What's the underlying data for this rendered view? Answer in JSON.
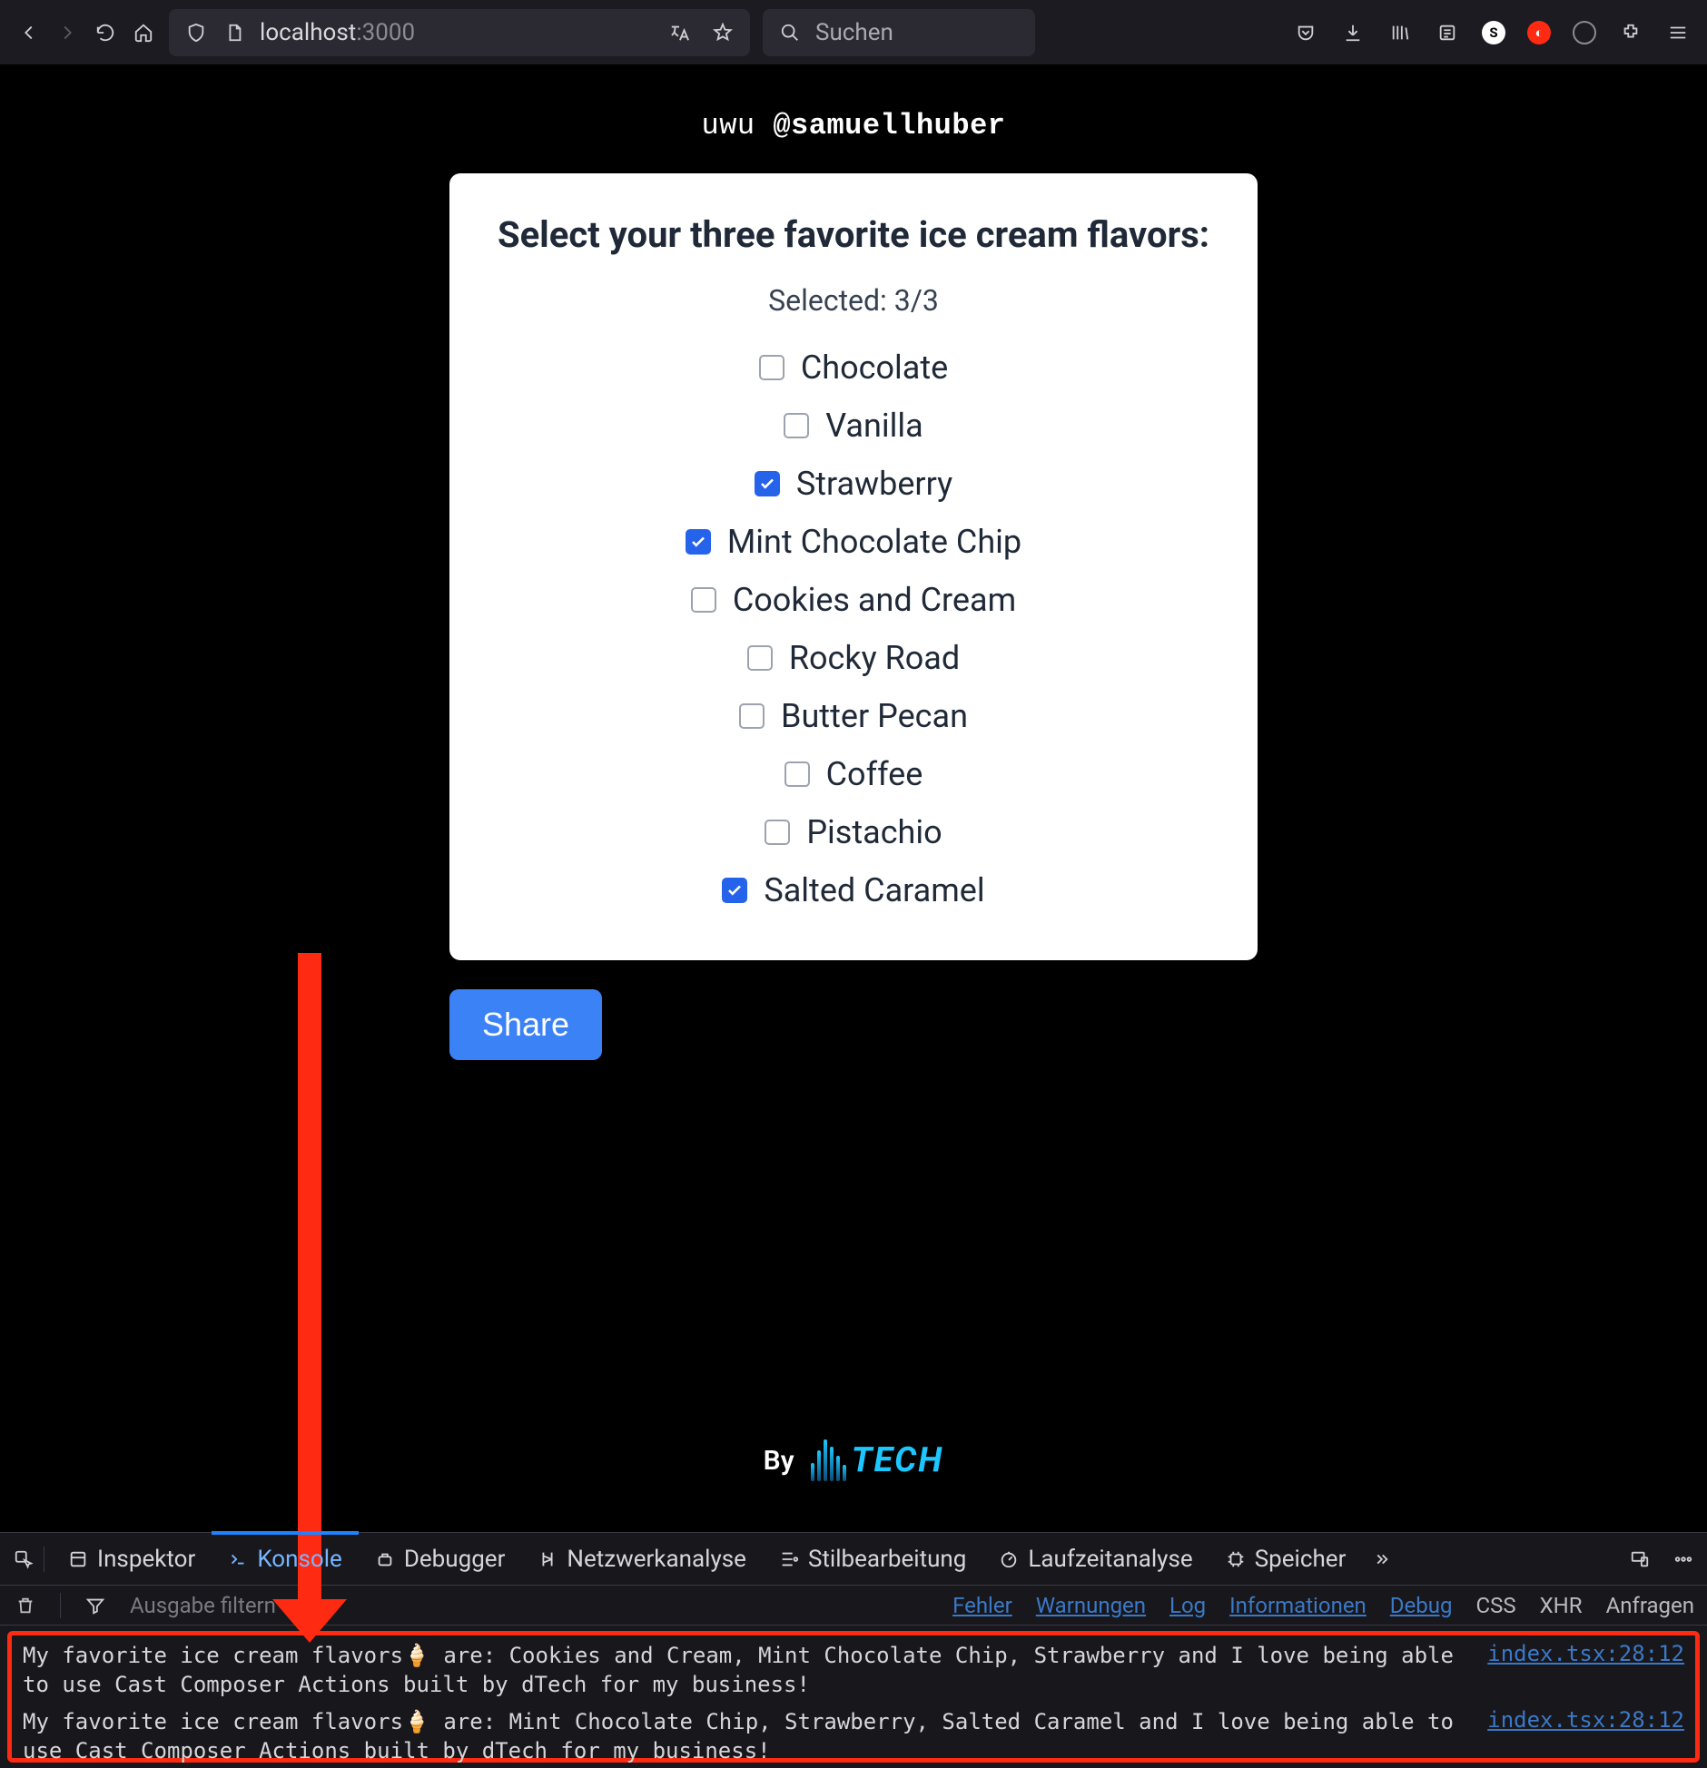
{
  "browser": {
    "url_prefix": "localhost",
    "url_port": ":3000",
    "search_placeholder": "Suchen"
  },
  "page": {
    "header_prefix": "uwu",
    "header_handle": "@samuellhuber",
    "card_title": "Select your three favorite ice cream flavors:",
    "selected_label": "Selected: 3/3",
    "flavors": [
      {
        "label": "Chocolate",
        "checked": false
      },
      {
        "label": "Vanilla",
        "checked": false
      },
      {
        "label": "Strawberry",
        "checked": true
      },
      {
        "label": "Mint Chocolate Chip",
        "checked": true
      },
      {
        "label": "Cookies and Cream",
        "checked": false
      },
      {
        "label": "Rocky Road",
        "checked": false
      },
      {
        "label": "Butter Pecan",
        "checked": false
      },
      {
        "label": "Coffee",
        "checked": false
      },
      {
        "label": "Pistachio",
        "checked": false
      },
      {
        "label": "Salted Caramel",
        "checked": true
      }
    ],
    "share_label": "Share",
    "footer_by": "By",
    "footer_brand": "TECH"
  },
  "devtools": {
    "tabs": [
      {
        "id": "inspector",
        "label": "Inspektor"
      },
      {
        "id": "console",
        "label": "Konsole"
      },
      {
        "id": "debugger",
        "label": "Debugger"
      },
      {
        "id": "network",
        "label": "Netzwerkanalyse"
      },
      {
        "id": "style",
        "label": "Stilbearbeitung"
      },
      {
        "id": "perf",
        "label": "Laufzeitanalyse"
      },
      {
        "id": "memory",
        "label": "Speicher"
      }
    ],
    "active_tab": "console",
    "filter_placeholder": "Ausgabe filtern",
    "levels": [
      {
        "label": "Fehler",
        "link": true
      },
      {
        "label": "Warnungen",
        "link": true
      },
      {
        "label": "Log",
        "link": true
      },
      {
        "label": "Informationen",
        "link": true
      },
      {
        "label": "Debug",
        "link": true
      },
      {
        "label": "CSS",
        "link": false
      },
      {
        "label": "XHR",
        "link": false
      },
      {
        "label": "Anfragen",
        "link": false
      }
    ],
    "messages": [
      {
        "text": "My favorite ice cream flavors🍦 are: Cookies and Cream, Mint Chocolate Chip, Strawberry and I love being able to use Cast Composer Actions built by dTech for my business!",
        "src": "index.tsx:28:12"
      },
      {
        "text": "My favorite ice cream flavors🍦 are: Mint Chocolate Chip, Strawberry, Salted Caramel and I love being able to use Cast Composer Actions built by dTech for my business!",
        "src": "index.tsx:28:12"
      }
    ]
  }
}
